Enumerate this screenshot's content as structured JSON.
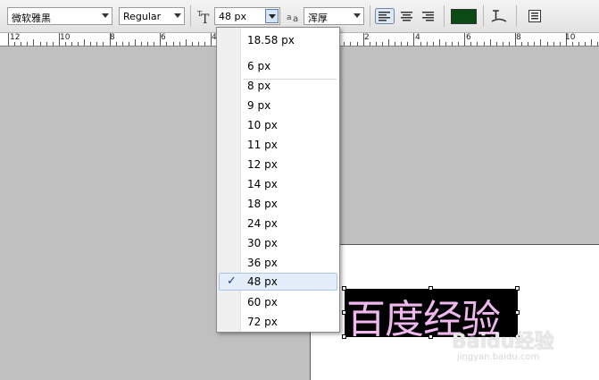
{
  "toolbar": {
    "font_family": "微软雅黑",
    "font_style": "Regular",
    "font_size": "48 px",
    "antialias": "浑厚",
    "text_color": "#0b4a12"
  },
  "ruler_labels": [
    "12",
    "10",
    "8",
    "6",
    "4",
    "2",
    "4",
    "6",
    "8",
    "10"
  ],
  "font_size_menu": {
    "current": "18.58 px",
    "options": [
      "6 px",
      "8 px",
      "9 px",
      "10 px",
      "11 px",
      "12 px",
      "14 px",
      "18 px",
      "24 px",
      "30 px",
      "36 px",
      "48 px",
      "60 px",
      "72 px"
    ],
    "selected": "48 px",
    "check": "✓"
  },
  "canvas": {
    "text": "百度经验"
  },
  "watermark": {
    "logo": "Baidu经验",
    "url": "jingyan.baidu.com"
  }
}
